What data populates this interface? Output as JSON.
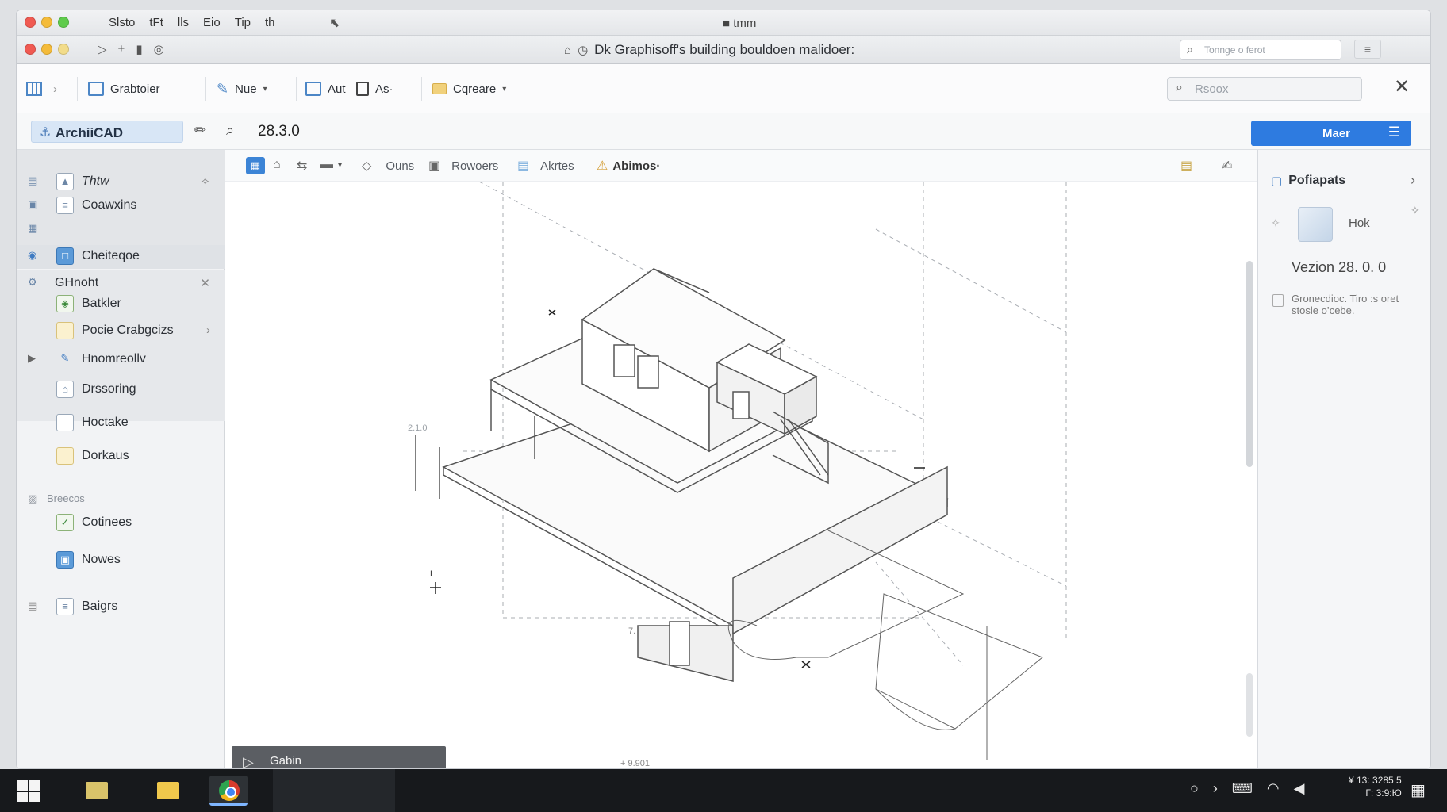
{
  "titlebar": {
    "menu_items": [
      "Slsto",
      "tFt",
      "lls",
      "Eio",
      "Tip",
      "th"
    ],
    "title": "tmm"
  },
  "titlebar2": {
    "title": "Dk Graphisoff's building bouldoen malidoer:",
    "search_placeholder": "Tonnge o ferot"
  },
  "toolbar": {
    "items": [
      "Grabtoier",
      "Nue",
      "Aut",
      "As·",
      "Cqreare"
    ],
    "search_placeholder": "Rsoox"
  },
  "bar2": {
    "app_name": "ArchiiCAD",
    "version": "28.3.0",
    "primary_button": "Maer"
  },
  "sidebar": {
    "items": [
      {
        "label": "Thtw"
      },
      {
        "label": "Coawxins"
      },
      {
        "label": "Cheiteqoe"
      },
      {
        "label": "GHnoht"
      },
      {
        "label": "Batkler"
      },
      {
        "label": "Pocie Crabgcizs"
      },
      {
        "label": "Hnomreollv"
      },
      {
        "label": "Drssoring"
      },
      {
        "label": "Hoctake"
      },
      {
        "label": "Dorkaus"
      },
      {
        "label": "Cotinees"
      },
      {
        "label": "Nowes"
      },
      {
        "label": "Baigrs"
      }
    ],
    "section_label": "Breecos"
  },
  "canvas_toolbar": {
    "items": [
      "Ouns",
      "Rowoers",
      "Akrtes",
      "Abimos·"
    ]
  },
  "canvas": {
    "labels": [
      "2.1.0",
      "L",
      "7.",
      "+ 9.901"
    ],
    "float_panel_label": "Gabin"
  },
  "right_panel": {
    "title": "Pofiapats",
    "cube_label": "Hok",
    "version": "Vezion 28. 0. 0",
    "note": "Gronecdioc. Tiro :s oret stosle o’cebe."
  },
  "taskbar": {
    "time": "¥ 13: 3285 5",
    "date": "Г: 3:9:Ю"
  },
  "colors": {
    "accent": "#2e7be0",
    "selected_chip": "#d8e6f6"
  }
}
